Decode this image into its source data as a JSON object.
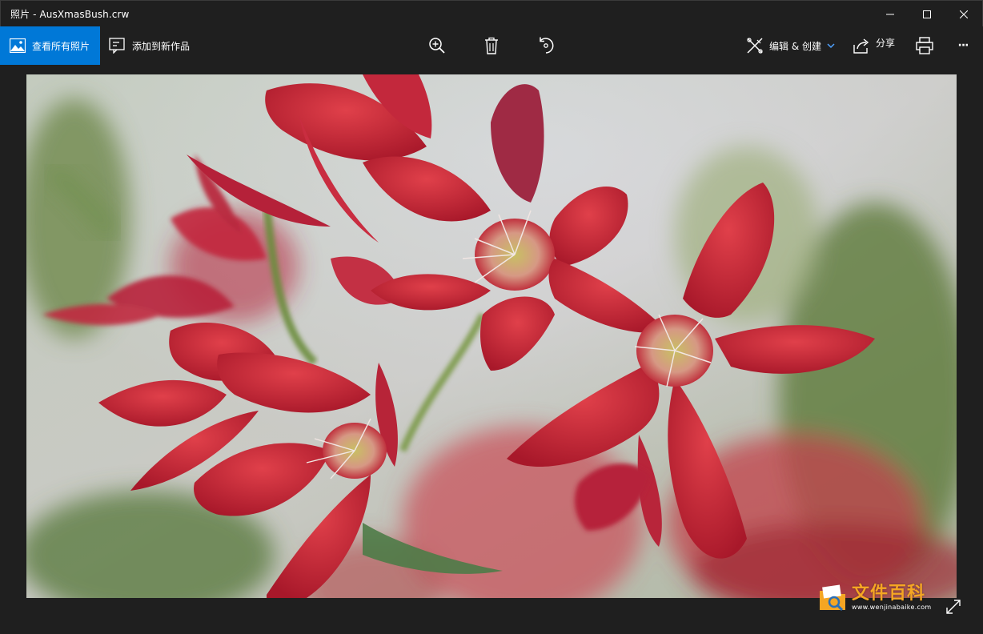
{
  "window": {
    "title": "照片 - AusXmasBush.crw",
    "controls": [
      "minimize-icon",
      "maximize-icon",
      "close-icon"
    ]
  },
  "toolbar": {
    "view_all_label": "查看所有照片",
    "add_to_creation_label": "添加到新作品",
    "zoom_icon": "zoom-in-icon",
    "delete_icon": "trash-icon",
    "rotate_icon": "rotate-icon",
    "edit_create_label": "编辑 & 创建",
    "share_label": "分享",
    "print_icon": "printer-icon",
    "more_label": "···"
  },
  "viewer": {
    "image_subject": "red flowers photo",
    "expand_icon": "expand-icon"
  },
  "watermark": {
    "title": "文件百科",
    "url": "www.wenjinabaike.com"
  },
  "colors": {
    "accent": "#0078d7",
    "background": "#1f1f1f",
    "watermark": "#f5a623"
  }
}
